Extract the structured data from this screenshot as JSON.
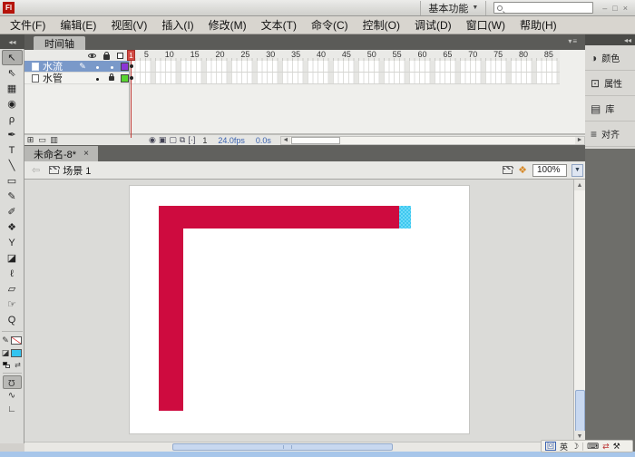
{
  "window": {
    "app_icon": "Fl",
    "workspace": "基本功能",
    "workspace_arrow": "▼",
    "minimize": "–",
    "restore": "□",
    "close": "×"
  },
  "menu": {
    "items": [
      "文件(F)",
      "编辑(E)",
      "视图(V)",
      "插入(I)",
      "修改(M)",
      "文本(T)",
      "命令(C)",
      "控制(O)",
      "调试(D)",
      "窗口(W)",
      "帮助(H)"
    ]
  },
  "panels": {
    "collapse_arrows": "◂◂",
    "dock_collapse_arrows": "◂◂",
    "panel_menu": "▾≡"
  },
  "timeline": {
    "tab": "时间轴",
    "layers": [
      {
        "name": "水流",
        "edit_glyph": "✎",
        "outline_color": "#8B35D6",
        "selected": true
      },
      {
        "name": "水管",
        "outline_color": "#58D432",
        "locked": true
      }
    ],
    "ruler": [
      "5",
      "10",
      "15",
      "20",
      "25",
      "30",
      "35",
      "40",
      "45",
      "50",
      "55",
      "60",
      "65",
      "70",
      "75",
      "80",
      "85"
    ],
    "current_frame": "1",
    "frame_rate": "24.0fps",
    "elapsed_time": "0.0s",
    "buttons": {
      "new_layer": "⊞",
      "new_folder": "▭",
      "delete_layer": "▥"
    },
    "onion_icons": [
      "◉",
      "▣",
      "▢",
      "⧉",
      "[·]"
    ],
    "scroll": {
      "left_arrow": "◄",
      "right_arrow": "►",
      "up_arrow": "▲",
      "down_arrow": "▼"
    }
  },
  "document": {
    "tab_title": "未命名-8*",
    "tab_close": "×"
  },
  "edit_bar": {
    "back_arrow": "⇦",
    "scene_label": "场景 1",
    "symbol_icon_glyph": "❖",
    "zoom_value": "100%",
    "zoom_arrow": "▼"
  },
  "tools": [
    {
      "name": "selection",
      "glyph": "↖"
    },
    {
      "name": "subselection",
      "glyph": "⇖"
    },
    {
      "name": "free-transform",
      "glyph": "▦"
    },
    {
      "name": "3d-rotation",
      "glyph": "◉"
    },
    {
      "name": "lasso",
      "glyph": "ρ"
    },
    {
      "name": "pen",
      "glyph": "✒"
    },
    {
      "name": "text",
      "glyph": "T"
    },
    {
      "name": "line",
      "glyph": "╲"
    },
    {
      "name": "rectangle",
      "glyph": "▭"
    },
    {
      "name": "pencil",
      "glyph": "✎"
    },
    {
      "name": "brush",
      "glyph": "✐"
    },
    {
      "name": "deco",
      "glyph": "❖"
    },
    {
      "name": "bone",
      "glyph": "Y"
    },
    {
      "name": "paint-bucket",
      "glyph": "◪"
    },
    {
      "name": "eyedropper",
      "glyph": "ℓ"
    },
    {
      "name": "eraser",
      "glyph": "▱"
    },
    {
      "name": "hand",
      "glyph": "☞"
    },
    {
      "name": "zoom",
      "glyph": "Q"
    }
  ],
  "tool_options": {
    "stroke_glyph": "✎",
    "fill_glyph": "◪",
    "swap_glyph": "⇄",
    "magnet_glyph": "Ω",
    "smooth_glyph": "∿",
    "straighten_glyph": "∟",
    "fill_color": "#33C4F0",
    "stroke_color": "none"
  },
  "dock": {
    "buttons": [
      {
        "icon": "◑",
        "label": "颜色"
      },
      {
        "icon": "⊡",
        "label": "属性"
      },
      {
        "icon": "▤",
        "label": "库"
      },
      {
        "icon": "≡",
        "label": "对齐"
      }
    ]
  },
  "canvas": {
    "pipe_color": "#CE0B3F",
    "selection_fill_color": "#3EC8EF",
    "shape": "L-shaped pipe, selected cyan segment at right end of horizontal bar"
  },
  "ime": {
    "logo": "回",
    "lang": "英",
    "moon": "☽",
    "keyboard": "⌨",
    "arrows": "⇄",
    "tools": "⚒"
  }
}
